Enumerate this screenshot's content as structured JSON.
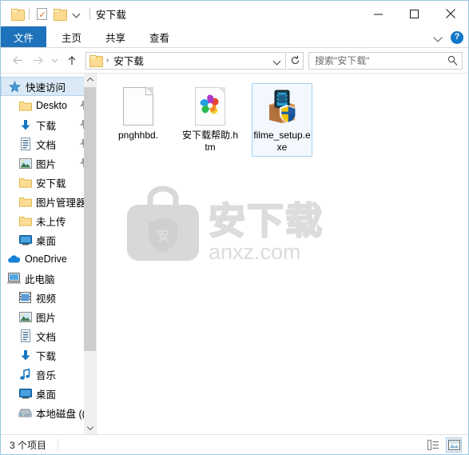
{
  "window": {
    "title": "安下载",
    "quick_access": [
      {
        "name": "folder-icon",
        "label": "文件夹"
      },
      {
        "name": "properties-icon",
        "label": "属性"
      },
      {
        "name": "new-folder-icon",
        "label": "新建文件夹"
      },
      {
        "name": "customize-qat-chevron",
        "label": "自定义快速访问工具栏"
      }
    ],
    "controls": {
      "minimize": "—",
      "maximize": "□",
      "close": "✕"
    }
  },
  "ribbon": {
    "tabs": [
      {
        "label": "文件",
        "active": true
      },
      {
        "label": "主页",
        "active": false
      },
      {
        "label": "共享",
        "active": false
      },
      {
        "label": "查看",
        "active": false
      }
    ],
    "expand_label": "展开功能区",
    "help_label": "?"
  },
  "address": {
    "back_label": "后退",
    "forward_label": "前进",
    "recent_label": "最近浏览的位置",
    "up_label": "上移一级",
    "breadcrumb": "安下载",
    "breadcrumb_separator": "›",
    "dropdown_label": "以前的位置",
    "refresh_label": "刷新",
    "path_placeholder": "安下载"
  },
  "search": {
    "placeholder": "搜索\"安下载\"",
    "icon": "search-icon"
  },
  "sidebar": {
    "items": [
      {
        "label": "快速访问",
        "icon": "pin-star-icon",
        "level": 0,
        "selected": true,
        "pinned": false
      },
      {
        "label": "Deskto",
        "icon": "folder-icon",
        "level": 1,
        "selected": false,
        "pinned": true
      },
      {
        "label": "下载",
        "icon": "download-icon",
        "level": 1,
        "selected": false,
        "pinned": true
      },
      {
        "label": "文档",
        "icon": "documents-icon",
        "level": 1,
        "selected": false,
        "pinned": true
      },
      {
        "label": "图片",
        "icon": "pictures-icon",
        "level": 1,
        "selected": false,
        "pinned": true
      },
      {
        "label": "安下载",
        "icon": "folder-icon",
        "level": 1,
        "selected": false,
        "pinned": false
      },
      {
        "label": "图片管理器",
        "icon": "folder-icon",
        "level": 1,
        "selected": false,
        "pinned": false
      },
      {
        "label": "未上传",
        "icon": "folder-icon",
        "level": 1,
        "selected": false,
        "pinned": false
      },
      {
        "label": "桌面",
        "icon": "desktop-icon",
        "level": 1,
        "selected": false,
        "pinned": false
      },
      {
        "label": "OneDrive",
        "icon": "onedrive-icon",
        "level": 0,
        "selected": false,
        "pinned": false
      },
      {
        "label": "此电脑",
        "icon": "this-pc-icon",
        "level": 0,
        "selected": false,
        "pinned": false
      },
      {
        "label": "视频",
        "icon": "videos-icon",
        "level": 1,
        "selected": false,
        "pinned": false
      },
      {
        "label": "图片",
        "icon": "pictures-icon",
        "level": 1,
        "selected": false,
        "pinned": false
      },
      {
        "label": "文档",
        "icon": "documents-icon",
        "level": 1,
        "selected": false,
        "pinned": false
      },
      {
        "label": "下载",
        "icon": "download-icon",
        "level": 1,
        "selected": false,
        "pinned": false
      },
      {
        "label": "音乐",
        "icon": "music-icon",
        "level": 1,
        "selected": false,
        "pinned": false
      },
      {
        "label": "桌面",
        "icon": "desktop-icon",
        "level": 1,
        "selected": false,
        "pinned": false
      },
      {
        "label": "本地磁盘 ((",
        "icon": "drive-icon",
        "level": 1,
        "selected": false,
        "pinned": false
      }
    ],
    "scroll_up_label": "向上滚动",
    "scroll_down_label": "向下滚动"
  },
  "files": [
    {
      "name": "pnghhbd.",
      "icon": "blank-document-icon",
      "selected": false
    },
    {
      "name": "安下载帮助.htm",
      "icon": "html-pinwheel-icon",
      "selected": false
    },
    {
      "name": "filme_setup.exe",
      "icon": "installer-box-shield-icon",
      "selected": true
    }
  ],
  "watermark": {
    "brand_cn": "安下载",
    "brand_url": "anxz.com",
    "shield_char": "安",
    "color": "#dcdcdc"
  },
  "statusbar": {
    "item_count": "3 个项目",
    "view_details_label": "详细信息",
    "view_large_icons_label": "大图标"
  },
  "colors": {
    "accent": "#1e72bb",
    "selection": "#dbe9f7",
    "window_border": "#9bc8e3",
    "folder_yellow": "#fcdc93",
    "help_blue": "#1177c9"
  }
}
